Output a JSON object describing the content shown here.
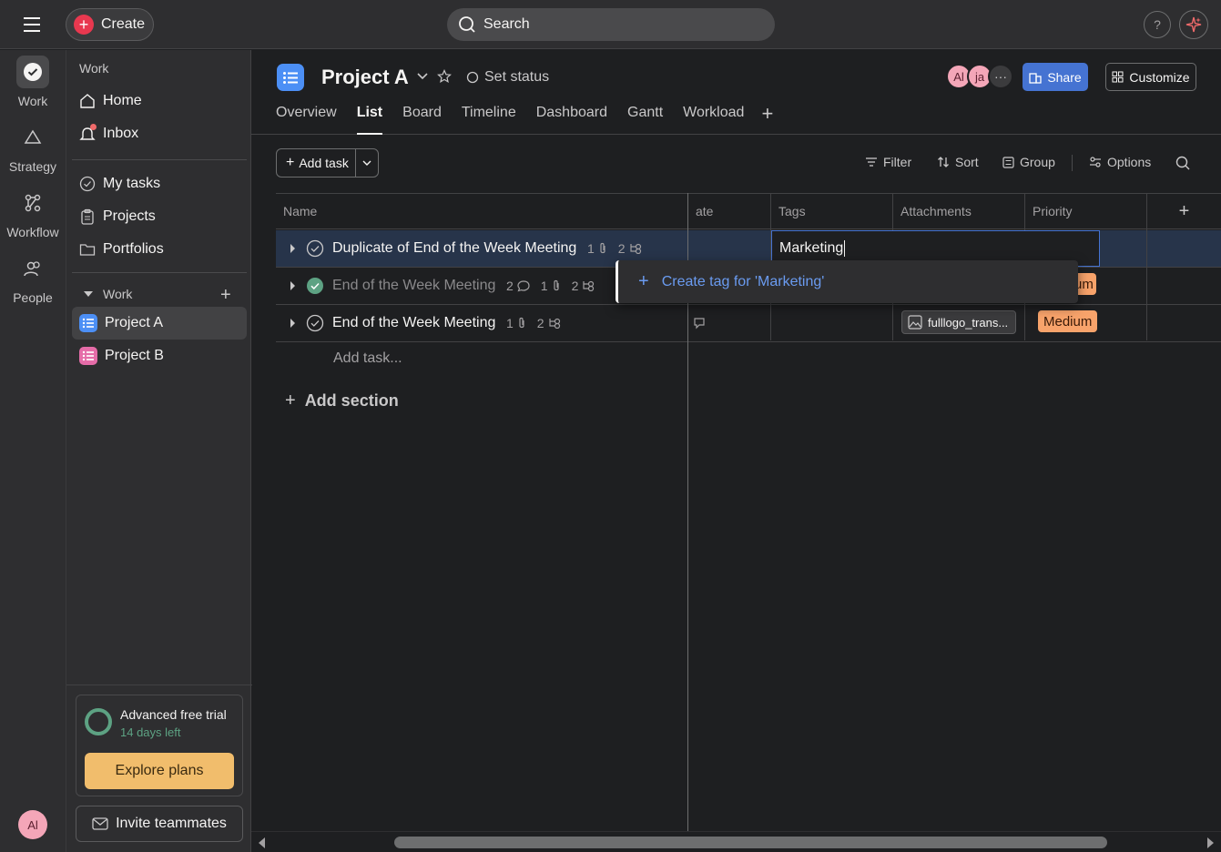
{
  "topbar": {
    "create_label": "Create",
    "search_placeholder": "Search",
    "help_label": "?"
  },
  "rail": {
    "items": [
      {
        "label": "Work",
        "icon": "check-circle-icon"
      },
      {
        "label": "Strategy",
        "icon": "triangle-icon"
      },
      {
        "label": "Workflow",
        "icon": "workflow-icon"
      },
      {
        "label": "People",
        "icon": "people-icon"
      }
    ],
    "user_initials": "Al"
  },
  "sidebar": {
    "heading": "Work",
    "nav": [
      {
        "label": "Home",
        "icon": "home-icon"
      },
      {
        "label": "Inbox",
        "icon": "bell-icon"
      }
    ],
    "nav2": [
      {
        "label": "My tasks",
        "icon": "check-circle-icon"
      },
      {
        "label": "Projects",
        "icon": "clipboard-icon"
      },
      {
        "label": "Portfolios",
        "icon": "folder-icon"
      }
    ],
    "section_label": "Work",
    "projects": [
      {
        "label": "Project A",
        "color": "#4c8ff5"
      },
      {
        "label": "Project B",
        "color": "#e56ca8"
      }
    ],
    "trial_title": "Advanced free trial",
    "trial_sub": "14 days left",
    "explore_label": "Explore plans",
    "invite_label": "Invite teammates"
  },
  "header": {
    "project_title": "Project A",
    "set_status": "Set status",
    "tabs": [
      "Overview",
      "List",
      "Board",
      "Timeline",
      "Dashboard",
      "Gantt",
      "Workload"
    ],
    "active_tab": "List",
    "members": [
      {
        "initials": "Al",
        "color": "#f4a6b8"
      },
      {
        "initials": "ja",
        "color": "#f4a6b8"
      }
    ],
    "share_label": "Share",
    "customize_label": "Customize"
  },
  "toolbar": {
    "add_task_label": "Add task",
    "filter_label": "Filter",
    "sort_label": "Sort",
    "group_label": "Group",
    "options_label": "Options"
  },
  "table": {
    "columns": [
      "Name",
      "ate",
      "Tags",
      "Attachments",
      "Priority"
    ],
    "rows": [
      {
        "name": "Duplicate of End of the Week Meeting",
        "comments": "",
        "attachments": "1",
        "subtasks": "2",
        "completed": false,
        "priority": ""
      },
      {
        "name": "End of the Week Meeting",
        "comments": "2",
        "attachments": "1",
        "subtasks": "2",
        "completed": true,
        "priority": "um"
      },
      {
        "name": "End of the Week Meeting",
        "comments": "",
        "attachments": "1",
        "subtasks": "2",
        "completed": false,
        "priority": "Medium",
        "attachment_file": "fulllogo_trans..."
      }
    ],
    "tag_input_value": "Marketing",
    "tag_popup_label": "Create tag for 'Marketing'",
    "add_task_row": "Add task...",
    "add_section": "Add section"
  },
  "colors": {
    "accent_blue": "#4573d2",
    "priority_medium": "#f8a36b",
    "success_green": "#5da283",
    "create_red": "#e8384f"
  }
}
